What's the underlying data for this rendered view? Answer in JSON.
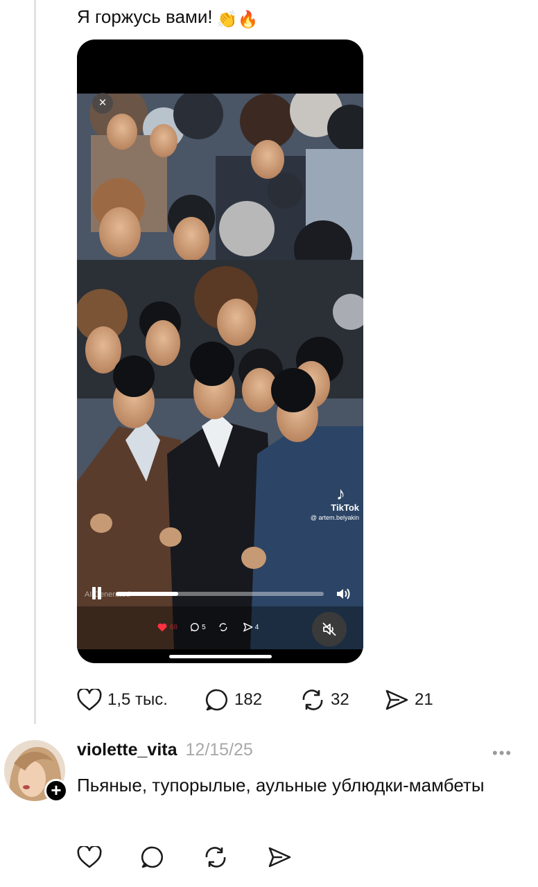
{
  "post": {
    "text": "Я горжусь вами!",
    "emoji": "👏🔥",
    "video": {
      "close_icon": "×",
      "watermark_brand": "TikTok",
      "watermark_user": "@ artem.belyakin",
      "ai_label": "AI Generated",
      "progress": 0.3,
      "mini_comments": "5",
      "mini_shares": "4",
      "mini_likes": "68"
    },
    "stats": {
      "likes": "1,5 тыс.",
      "comments": "182",
      "reposts": "32",
      "shares": "21"
    }
  },
  "comment": {
    "username": "violette_vita",
    "date": "12/15/25",
    "text": "Пьяные, тупорылые, аульные ублюдки-мамбеты",
    "more": "•••",
    "follow": "+"
  },
  "colors": {
    "text": "#101010",
    "muted": "#a8a8a8",
    "like_red": "#ff3040"
  }
}
